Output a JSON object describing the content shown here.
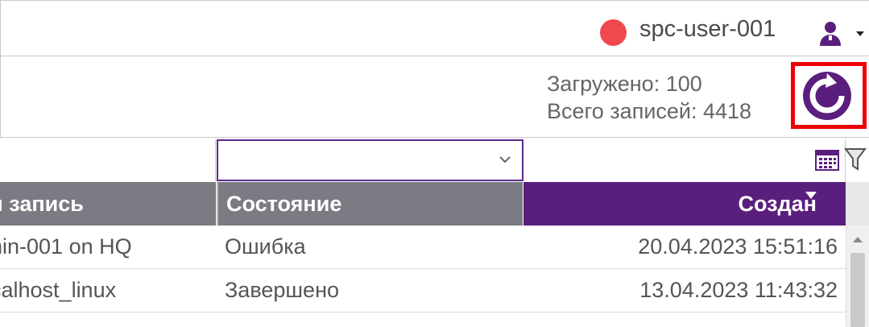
{
  "header": {
    "status_color": "#f0484e",
    "username": "spc-user-001",
    "icons": [
      "user-icon",
      "chevron-down-icon"
    ]
  },
  "toolbar": {
    "loaded_text": "Загружено: 100",
    "total_text": "Всего записей: 4418",
    "refresh_icon": "refresh-icon",
    "highlight_color": "#ee0000"
  },
  "filters": {
    "select_value": "",
    "icons": [
      "calendar-icon",
      "filter-icon"
    ]
  },
  "table": {
    "columns": [
      "я запись",
      "Состояние",
      "Создан"
    ],
    "sorted_column": "Создан",
    "rows": [
      {
        "record": "nin-001 on HQ",
        "state": "Ошибка",
        "created": "20.04.2023 15:51:16"
      },
      {
        "record": "calhost_linux",
        "state": "Завершено",
        "created": "13.04.2023 11:43:32"
      }
    ]
  },
  "colors": {
    "accent": "#5a1f7d",
    "header_gray": "#7b7b83"
  }
}
